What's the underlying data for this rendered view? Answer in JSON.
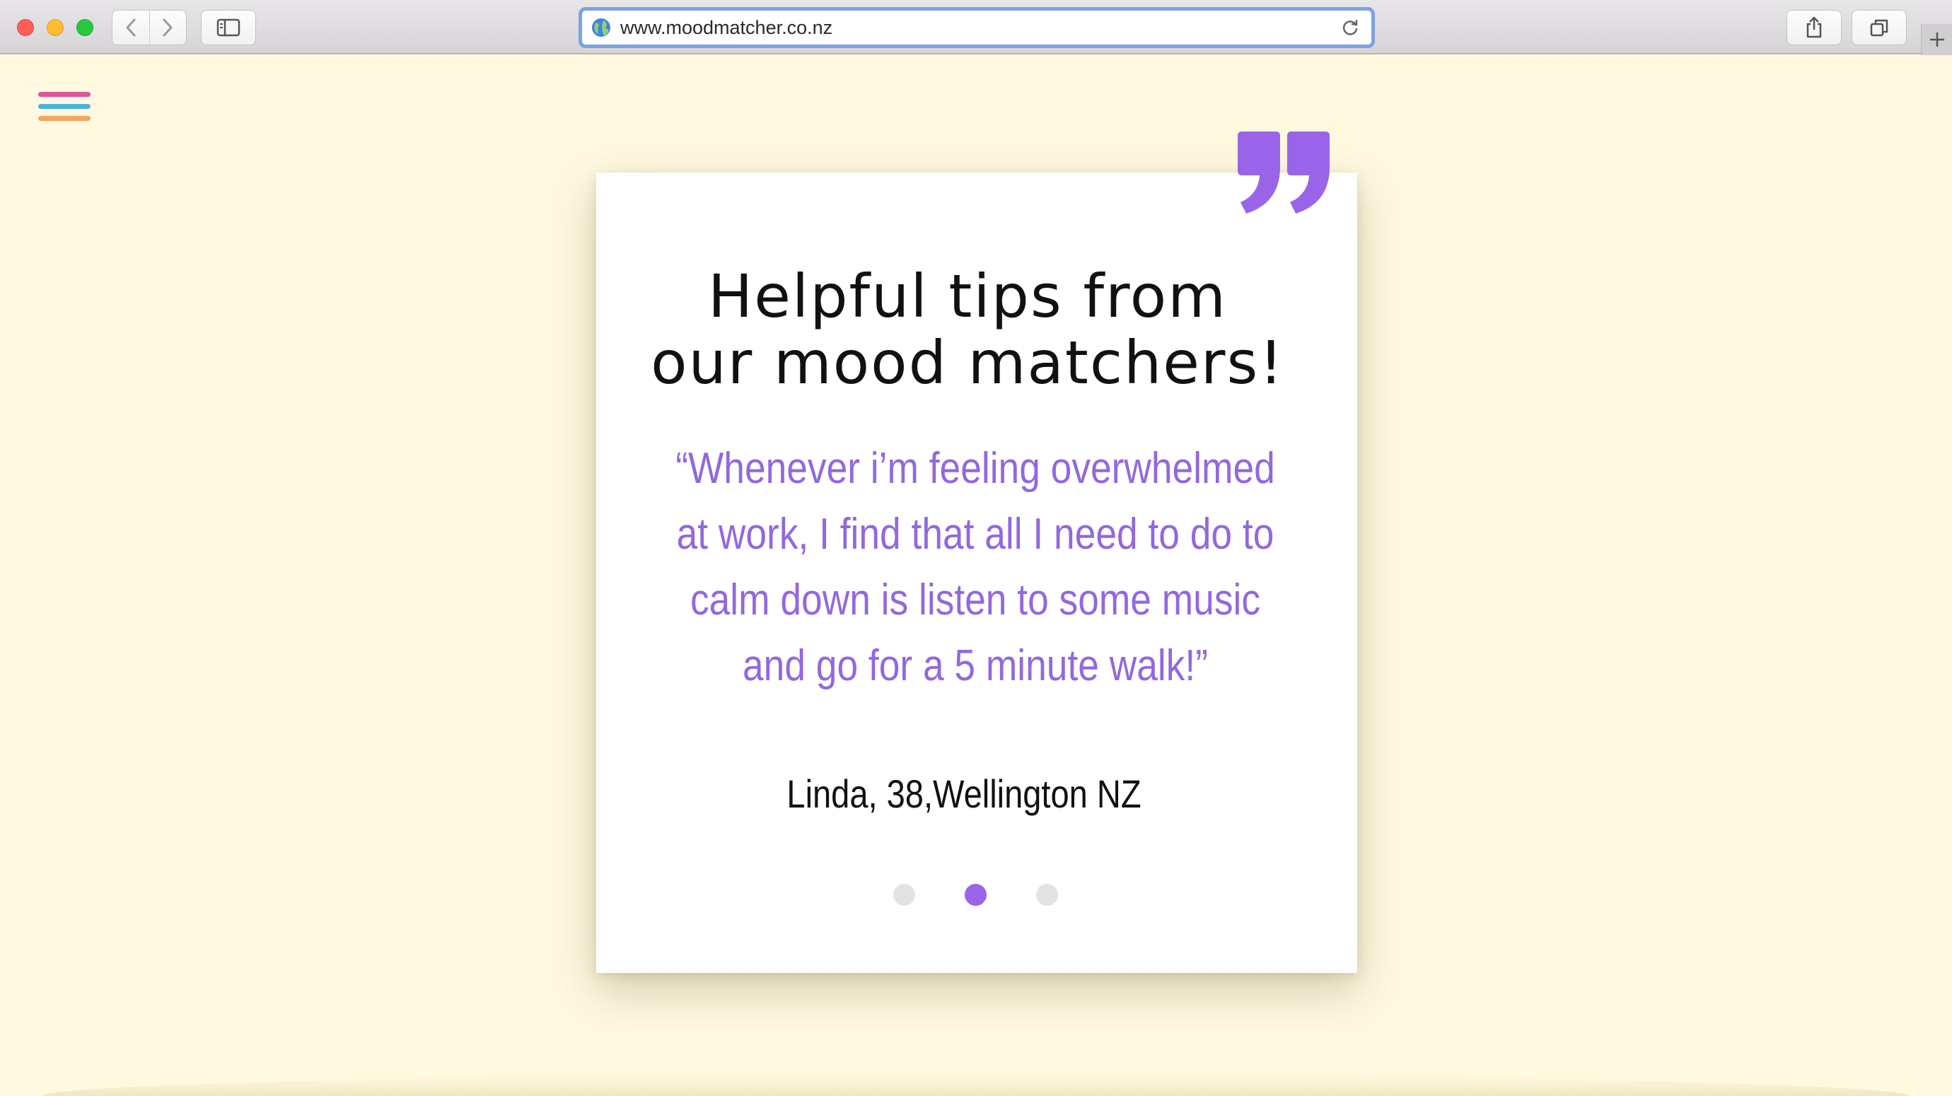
{
  "browser": {
    "url": "www.moodmatcher.co.nz",
    "icons": {
      "back": "chevron-left-icon",
      "forward": "chevron-right-icon",
      "sidebar": "sidebar-icon",
      "site": "globe-icon",
      "reload": "reload-icon",
      "share": "share-icon",
      "tabs": "tabs-icon",
      "new_tab": "plus-icon"
    }
  },
  "page": {
    "menu_icon": "hamburger-menu-icon",
    "menu_colors": [
      "#e0529a",
      "#4bb4d9",
      "#f6a45d"
    ],
    "background_color": "#fff9e0",
    "accent_color": "#9268e0"
  },
  "testimonial": {
    "heading_line1": "Helpful tips from",
    "heading_line2": "our mood matchers!",
    "quote_lines": [
      "“Whenever i’m feeling overwhelmed",
      "at work, I find that all I need to do to",
      "calm down is listen to some music",
      "and go for a 5 minute walk!”"
    ],
    "author": "Linda, 38,Wellington NZ",
    "quote_icon": "quote-mark-icon",
    "carousel": {
      "count": 3,
      "active_index": 1
    }
  }
}
